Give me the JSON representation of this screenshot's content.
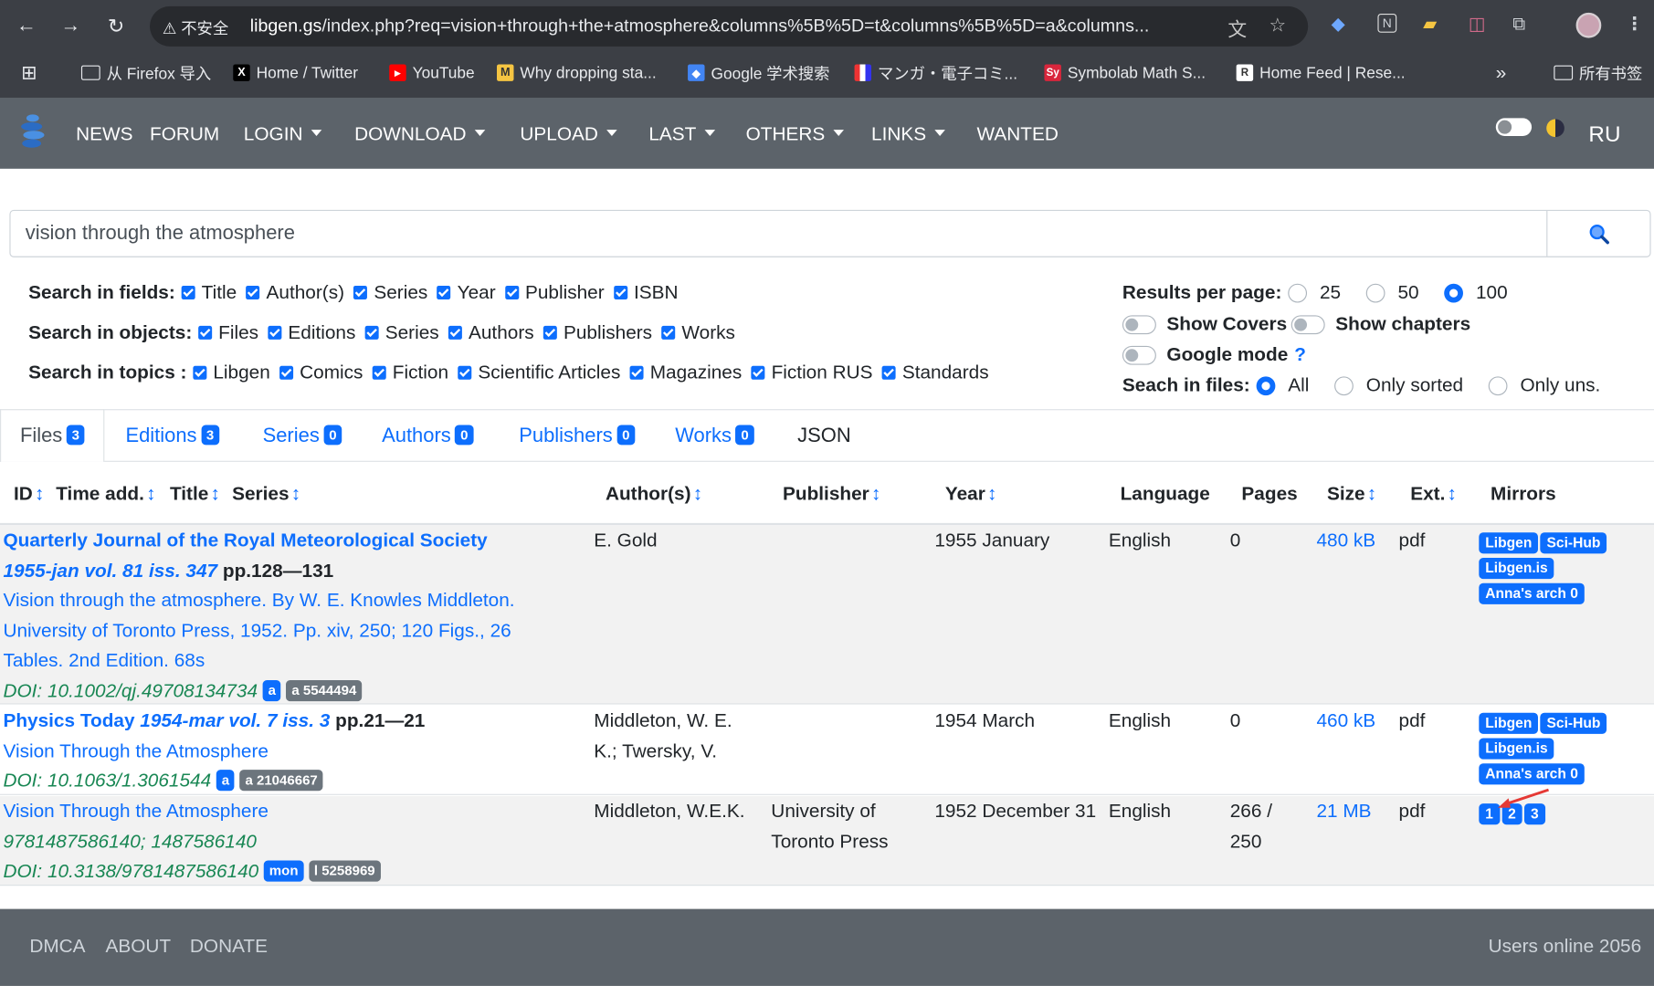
{
  "browser": {
    "insecure_label": "不安全",
    "url_host": "libgen.gs",
    "url_path": "/index.php?req=vision+through+the+atmosphere&columns%5B%5D=t&columns%5B%5D=a&columns...",
    "bookmarks": [
      {
        "label": "从 Firefox 导入",
        "icon": "folder-icon"
      },
      {
        "label": "Home / Twitter",
        "icon": "x-icon"
      },
      {
        "label": "YouTube",
        "icon": "youtube-icon"
      },
      {
        "label": "Why dropping sta...",
        "icon": "m-icon"
      },
      {
        "label": "Google 学术搜索",
        "icon": "scholar-icon"
      },
      {
        "label": "マンガ・電子コミ...",
        "icon": "manga-icon"
      },
      {
        "label": "Symbolab Math S...",
        "icon": "symbolab-icon"
      },
      {
        "label": "Home Feed | Rese...",
        "icon": "researchgate-icon"
      }
    ],
    "all_bookmarks": "所有书签",
    "more": "»"
  },
  "nav": {
    "items": [
      "NEWS",
      "FORUM",
      "LOGIN",
      "DOWNLOAD",
      "UPLOAD",
      "LAST",
      "OTHERS",
      "LINKS",
      "WANTED"
    ],
    "lang": "RU"
  },
  "search": {
    "query": "vision through the atmosphere",
    "fields_label": "Search in fields:",
    "fields": [
      "Title",
      "Author(s)",
      "Series",
      "Year",
      "Publisher",
      "ISBN"
    ],
    "objects_label": "Search in objects:",
    "objects": [
      "Files",
      "Editions",
      "Series",
      "Authors",
      "Publishers",
      "Works"
    ],
    "topics_label": "Search in topics :",
    "topics": [
      "Libgen",
      "Comics",
      "Fiction",
      "Scientific Articles",
      "Magazines",
      "Fiction RUS",
      "Standards"
    ],
    "results_label": "Results per page:",
    "results_options": [
      "25",
      "50",
      "100"
    ],
    "results_selected": "100",
    "show_covers": "Show Covers",
    "show_chapters": "Show chapters",
    "google_mode": "Google mode",
    "google_help": "?",
    "search_files_label": "Seach in files:",
    "search_files_options": [
      "All",
      "Only sorted",
      "Only uns."
    ]
  },
  "tabs": [
    {
      "label": "Files",
      "count": "3"
    },
    {
      "label": "Editions",
      "count": "3"
    },
    {
      "label": "Series",
      "count": "0"
    },
    {
      "label": "Authors",
      "count": "0"
    },
    {
      "label": "Publishers",
      "count": "0"
    },
    {
      "label": "Works",
      "count": "0"
    },
    {
      "label": "JSON",
      "count": ""
    }
  ],
  "columns": {
    "id": "ID",
    "time": "Time add.",
    "title": "Title",
    "series": "Series",
    "authors": "Author(s)",
    "publisher": "Publisher",
    "year": "Year",
    "language": "Language",
    "pages": "Pages",
    "size": "Size",
    "ext": "Ext.",
    "mirrors": "Mirrors",
    "sort_arrow": "↕"
  },
  "rows": [
    {
      "journal": "Quarterly Journal of the Royal Meteorological Society",
      "issue": "1955-jan vol. 81 iss. 347",
      "pages_ref": "pp.128—131",
      "title_lines": [
        "Vision through the atmosphere. By W. E. Knowles Middleton.",
        "University of Toronto Press, 1952. Pp. xiv, 250; 120 Figs., 26",
        "Tables. 2nd Edition. 68s"
      ],
      "doi": "DOI: 10.1002/qj.49708134734",
      "badge1": "a",
      "badge2": "a 5544494",
      "authors_lines": [
        "E. Gold"
      ],
      "publisher_lines": [],
      "year": "1955 January",
      "language": "English",
      "pages_lines": [
        "0"
      ],
      "size": "480 kB",
      "ext": "pdf",
      "mirrors": [
        "Libgen",
        "Sci-Hub",
        "Libgen.is",
        "Anna's arch 0"
      ]
    },
    {
      "journal": "Physics Today",
      "issue": "1954-mar vol. 7 iss. 3",
      "pages_ref": "pp.21—21",
      "title_lines": [
        "Vision Through the Atmosphere"
      ],
      "doi": "DOI: 10.1063/1.3061544",
      "badge1": "a",
      "badge2": "a 21046667",
      "authors_lines": [
        "Middleton, W. E.",
        "K.; Twersky, V."
      ],
      "publisher_lines": [],
      "year": "1954 March",
      "language": "English",
      "pages_lines": [
        "0"
      ],
      "size": "460 kB",
      "ext": "pdf",
      "mirrors": [
        "Libgen",
        "Sci-Hub",
        "Libgen.is",
        "Anna's arch 0"
      ]
    },
    {
      "journal": "",
      "issue": "",
      "pages_ref": "",
      "title_lines": [
        "Vision Through the Atmosphere"
      ],
      "isbn": "9781487586140; 1487586140",
      "doi": "DOI: 10.3138/9781487586140",
      "badge1": "mon",
      "badge2": "l 5258969",
      "authors_lines": [
        "Middleton, W.E.K."
      ],
      "publisher_lines": [
        "University of",
        "Toronto Press"
      ],
      "year": "1952 December 31",
      "language": "English",
      "pages_lines": [
        "266 /",
        "250"
      ],
      "size": "21 MB",
      "ext": "pdf",
      "mirrors": [
        "1",
        "2",
        "3"
      ]
    }
  ],
  "footer": {
    "links": [
      "DMCA",
      "ABOUT",
      "DONATE"
    ],
    "users_online": "Users online 2056"
  },
  "colors": {
    "accent": "#0d6efd",
    "navbar": "#5c636a",
    "doi_green": "#198754",
    "badge_grey": "#6c757d"
  }
}
